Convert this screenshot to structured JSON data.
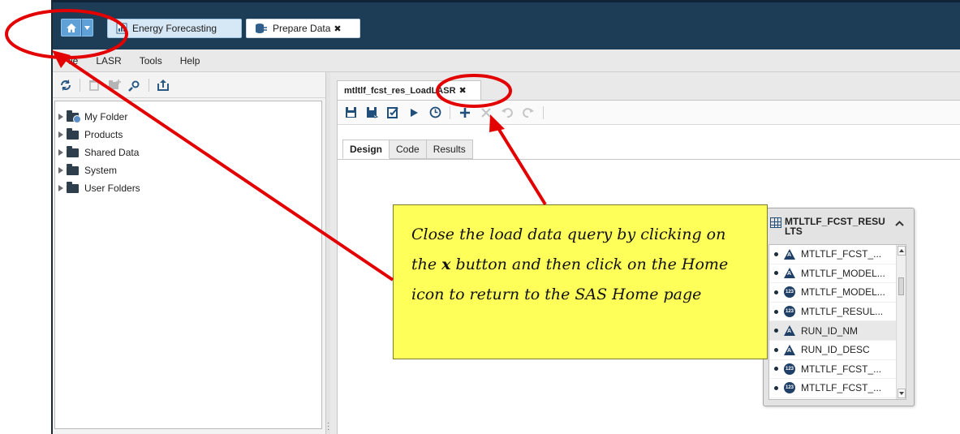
{
  "header": {
    "tabs": [
      {
        "label": "Energy Forecasting",
        "icon": "report-icon"
      },
      {
        "label": "Prepare Data",
        "icon": "prepare-data-icon",
        "close": "✖"
      }
    ]
  },
  "menu": {
    "items": [
      "File",
      "LASR",
      "Tools",
      "Help"
    ]
  },
  "sidebar": {
    "tree": [
      {
        "label": "My Folder",
        "icon": "user-folder-icon"
      },
      {
        "label": "Products",
        "icon": "folder-icon"
      },
      {
        "label": "Shared Data",
        "icon": "folder-icon"
      },
      {
        "label": "System",
        "icon": "folder-icon"
      },
      {
        "label": "User Folders",
        "icon": "folder-icon"
      }
    ]
  },
  "document": {
    "tab_label": "mtltlf_fcst_res_LoadLASR",
    "tab_close": "✖",
    "subtabs": [
      "Design",
      "Code",
      "Results"
    ],
    "active_subtab": "Design"
  },
  "table_node": {
    "title": "MTLTLF_FCST_RESU LTS",
    "columns": [
      {
        "name": "MTLTLF_FCST_...",
        "type": "char"
      },
      {
        "name": "MTLTLF_MODEL...",
        "type": "char"
      },
      {
        "name": "MTLTLF_MODEL...",
        "type": "num"
      },
      {
        "name": "MTLTLF_RESUL...",
        "type": "num"
      },
      {
        "name": "RUN_ID_NM",
        "type": "char"
      },
      {
        "name": "RUN_ID_DESC",
        "type": "char"
      },
      {
        "name": "MTLTLF_FCST_...",
        "type": "num"
      },
      {
        "name": "MTLTLF_FCST_...",
        "type": "num"
      }
    ],
    "num_icon_text": "123",
    "char_icon_text": "A"
  },
  "callout": {
    "text_before": "Close the load data query by clicking on the ",
    "emphasis": "x",
    "text_after": " button and then click on the Home icon to return to the SAS Home page"
  },
  "colors": {
    "title_bar": "#1d3c55",
    "callout_bg": "#ffff5a",
    "annotation_red": "#e30000"
  }
}
